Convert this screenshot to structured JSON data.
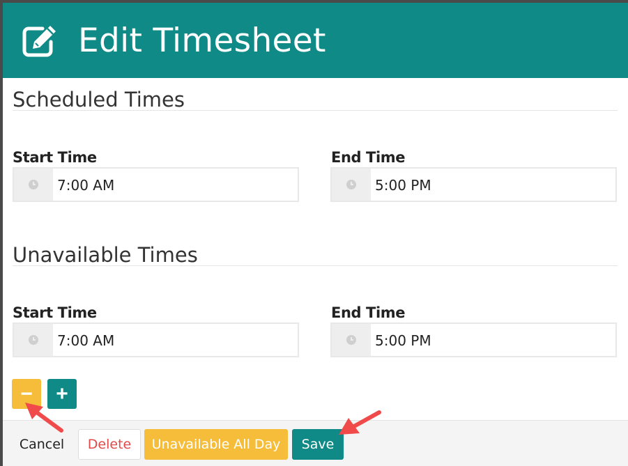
{
  "header": {
    "title": "Edit Timesheet",
    "icon": "edit-icon",
    "color": "#0f8a86"
  },
  "scheduled": {
    "title": "Scheduled Times",
    "start_label": "Start Time",
    "start_value": "7:00 AM",
    "end_label": "End Time",
    "end_value": "5:00 PM"
  },
  "unavailable": {
    "title": "Unavailable Times",
    "start_label": "Start Time",
    "start_value": "7:00 AM",
    "end_label": "End Time",
    "end_value": "5:00 PM"
  },
  "controls": {
    "remove_symbol": "−",
    "add_symbol": "+"
  },
  "footer": {
    "cancel_label": "Cancel",
    "delete_label": "Delete",
    "unavailable_all_day_label": "Unavailable All Day",
    "save_label": "Save"
  },
  "colors": {
    "teal": "#0f8a86",
    "amber": "#f6bd3a",
    "danger": "#e04a4a",
    "annotation_arrow": "#f04a4a"
  }
}
